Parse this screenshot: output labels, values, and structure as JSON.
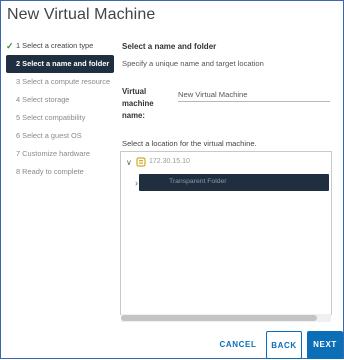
{
  "window": {
    "title": "New Virtual Machine"
  },
  "steps": [
    {
      "label": "1 Select a creation type",
      "state": "done"
    },
    {
      "label": "2 Select a name and folder",
      "state": "active"
    },
    {
      "label": "3 Select a compute resource",
      "state": "pending"
    },
    {
      "label": "4 Select storage",
      "state": "pending"
    },
    {
      "label": "5 Select compatibility",
      "state": "pending"
    },
    {
      "label": "6 Select a guest OS",
      "state": "pending"
    },
    {
      "label": "7 Customize hardware",
      "state": "pending"
    },
    {
      "label": "8 Ready to complete",
      "state": "pending"
    }
  ],
  "content": {
    "heading": "Select a name and folder",
    "subheading": "Specify a unique name and target location",
    "vm_name_label": "Virtual machine name:",
    "vm_name_value": "New Virtual Machine",
    "location_label": "Select a location for the virtual machine."
  },
  "tree": {
    "datacenter_name": "172.30.15.10",
    "folder_name": "Transparent Folder"
  },
  "buttons": {
    "cancel": "CANCEL",
    "back": "BACK",
    "next": "NEXT"
  },
  "colors": {
    "accent": "#0b6fb8",
    "selected_row": "#1f2f3f",
    "check": "#3c8c2f"
  }
}
